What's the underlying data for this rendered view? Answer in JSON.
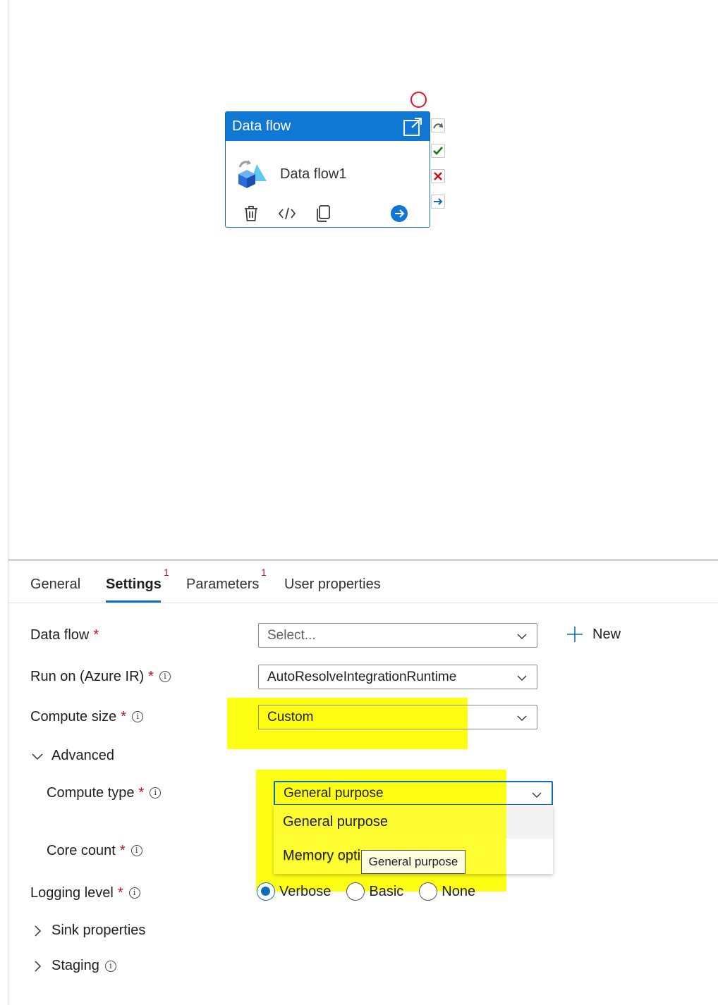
{
  "activity": {
    "type_label": "Data flow",
    "name": "Data flow1"
  },
  "tabs": [
    {
      "label": "General",
      "badge": ""
    },
    {
      "label": "Settings",
      "badge": "1"
    },
    {
      "label": "Parameters",
      "badge": "1"
    },
    {
      "label": "User properties",
      "badge": ""
    }
  ],
  "settings": {
    "data_flow": {
      "label": "Data flow",
      "required": "*",
      "value": "Select..."
    },
    "new_button": "New",
    "run_on": {
      "label": "Run on (Azure IR)",
      "required": "*",
      "value": "AutoResolveIntegrationRuntime"
    },
    "compute_size": {
      "label": "Compute size",
      "required": "*",
      "value": "Custom"
    },
    "advanced": {
      "label": "Advanced"
    },
    "compute_type": {
      "label": "Compute type",
      "required": "*",
      "value": "General purpose",
      "options": [
        "General purpose",
        "Memory opti"
      ],
      "tooltip": "General purpose"
    },
    "core_count": {
      "label": "Core count",
      "required": "*"
    },
    "logging_level": {
      "label": "Logging level",
      "required": "*",
      "options": [
        "Verbose",
        "Basic",
        "None"
      ],
      "selected": "Verbose"
    },
    "sink_properties": {
      "label": "Sink properties"
    },
    "staging": {
      "label": "Staging"
    }
  },
  "colors": {
    "accent": "#0f78d4",
    "highlight": "#ffff00",
    "required": "#c50f1f",
    "error": "#e81123"
  }
}
